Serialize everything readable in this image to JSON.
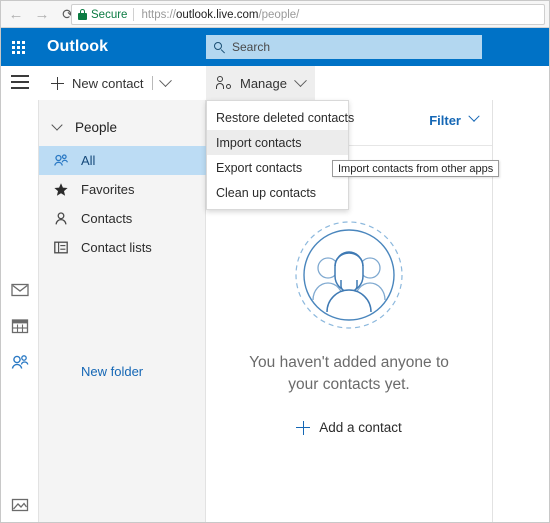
{
  "browser": {
    "back_icon": "arrow-left-icon",
    "forward_icon": "arrow-right-icon",
    "reload_icon": "reload-icon",
    "secure_label": "Secure",
    "url_scheme": "https://",
    "url_host": "outlook.live.com",
    "url_path": "/people/"
  },
  "header": {
    "waffle_icon": "app-launcher-icon",
    "brand": "Outlook",
    "search_placeholder": "Search",
    "background_color": "#0072c6",
    "search_background_color": "#b3d7f0"
  },
  "toolbar": {
    "menu_icon": "hamburger-icon",
    "new_contact_label": "New contact",
    "manage_label": "Manage",
    "manage_active_color": "#eeeeee"
  },
  "rail": {
    "items": [
      {
        "name": "mail",
        "icon": "mail-icon",
        "active": false
      },
      {
        "name": "calendar",
        "icon": "calendar-icon",
        "active": false
      },
      {
        "name": "people",
        "icon": "people-icon",
        "active": true
      },
      {
        "name": "files",
        "icon": "photos-icon",
        "active": false
      }
    ],
    "active_color": "#2a79c4"
  },
  "sidebar": {
    "group_label": "People",
    "items": [
      {
        "label": "All",
        "icon": "people-icon",
        "selected": true
      },
      {
        "label": "Favorites",
        "icon": "star-icon",
        "selected": false
      },
      {
        "label": "Contacts",
        "icon": "person-icon",
        "selected": false
      },
      {
        "label": "Contact lists",
        "icon": "contact-list-icon",
        "selected": false
      }
    ],
    "new_folder_label": "New folder",
    "selected_color": "#bcdcf4",
    "link_color": "#1567b5"
  },
  "list_pane": {
    "filter_label": "Filter",
    "empty_illustration": "people-circle-illustration",
    "empty_line1": "You haven't added anyone to",
    "empty_line2": "your contacts yet.",
    "add_contact_label": "Add a contact"
  },
  "menu": {
    "items": [
      {
        "label": "Restore deleted contacts",
        "hovered": false
      },
      {
        "label": "Import contacts",
        "hovered": true
      },
      {
        "label": "Export contacts",
        "hovered": false
      },
      {
        "label": "Clean up contacts",
        "hovered": false
      }
    ],
    "hover_color": "#ececec"
  },
  "tooltip": {
    "text": "Import contacts from other apps"
  }
}
